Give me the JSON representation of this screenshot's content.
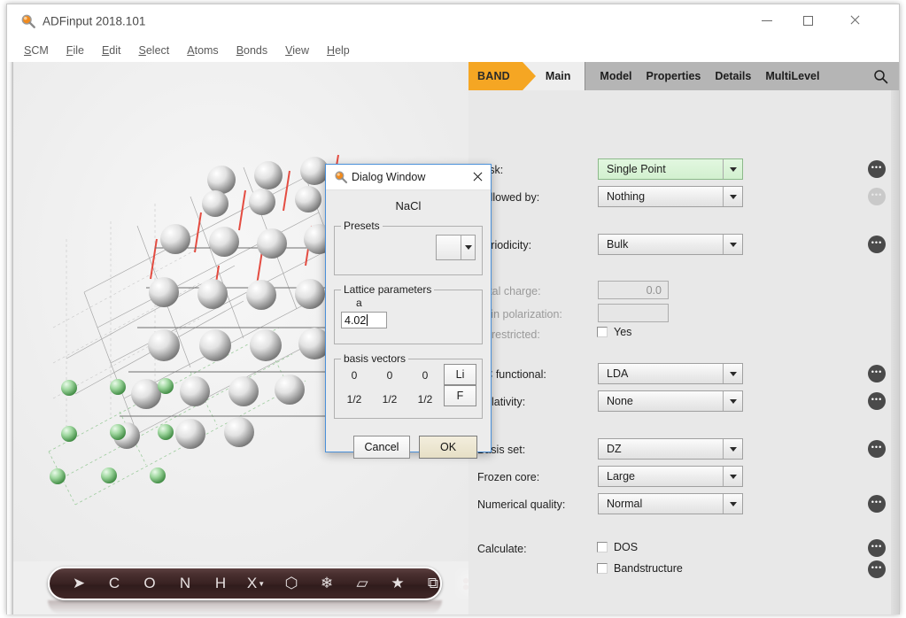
{
  "window": {
    "title": "ADFinput 2018.101",
    "icon": "magnifier-icon",
    "minimize_label": "Minimize",
    "maximize_label": "Maximize",
    "close_label": "Close"
  },
  "menubar": {
    "items": [
      {
        "label": "SCM",
        "accel": "S",
        "rest": "CM"
      },
      {
        "label": "File",
        "accel": "F",
        "rest": "ile"
      },
      {
        "label": "Edit",
        "accel": "E",
        "rest": "dit"
      },
      {
        "label": "Select",
        "accel": "S",
        "rest": "elect"
      },
      {
        "label": "Atoms",
        "accel": "A",
        "rest": "toms"
      },
      {
        "label": "Bonds",
        "accel": "B",
        "rest": "onds"
      },
      {
        "label": "View",
        "accel": "V",
        "rest": "iew"
      },
      {
        "label": "Help",
        "accel": "H",
        "rest": "elp"
      }
    ]
  },
  "toolbar": {
    "buttons": [
      {
        "name": "select-arrow-tool",
        "label": "➤"
      },
      {
        "name": "carbon-tool",
        "label": "C"
      },
      {
        "name": "oxygen-tool",
        "label": "O"
      },
      {
        "name": "nitrogen-tool",
        "label": "N"
      },
      {
        "name": "hydrogen-tool",
        "label": "H"
      },
      {
        "name": "element-x-tool",
        "label": "X"
      },
      {
        "name": "ring-tool",
        "label": "⬡"
      },
      {
        "name": "snowflake-tool",
        "label": "❄"
      },
      {
        "name": "plane-tool",
        "label": "▱"
      },
      {
        "name": "star-tool",
        "label": "★"
      },
      {
        "name": "box-tool",
        "label": "⧉"
      },
      {
        "name": "dots-tool",
        "label": "⁙",
        "selected": true
      }
    ]
  },
  "panel": {
    "product_tag": "BAND",
    "tabs": [
      {
        "label": "Main",
        "active": true
      },
      {
        "label": "Model",
        "active": false
      },
      {
        "label": "Properties",
        "active": false
      },
      {
        "label": "Details",
        "active": false
      },
      {
        "label": "MultiLevel",
        "active": false
      }
    ],
    "search_icon": "search-icon",
    "fields": [
      {
        "label": "Task:",
        "value": "Single Point",
        "type": "combo",
        "highlight": "#d6f2d2",
        "dots": "active"
      },
      {
        "label": "Followed by:",
        "value": "Nothing",
        "type": "combo",
        "dots": "disabled"
      },
      {
        "label": "Periodicity:",
        "value": "Bulk",
        "type": "combo",
        "dots": "active"
      },
      {
        "label": "Total charge:",
        "value": "0.0",
        "type": "text",
        "disabled": true
      },
      {
        "label": "Spin polarization:",
        "value": "",
        "type": "text",
        "disabled": true
      },
      {
        "label": "Unrestricted:",
        "value": "Yes",
        "type": "checkbox",
        "checked": false
      },
      {
        "label": "XC functional:",
        "value": "LDA",
        "type": "combo",
        "dots": "active"
      },
      {
        "label": "Relativity:",
        "value": "None",
        "type": "combo",
        "dots": "active"
      },
      {
        "label": "Basis set:",
        "value": "DZ",
        "type": "combo",
        "dots": "active"
      },
      {
        "label": "Frozen core:",
        "value": "Large",
        "type": "combo"
      },
      {
        "label": "Numerical quality:",
        "value": "Normal",
        "type": "combo",
        "dots": "active"
      },
      {
        "label": "Calculate:",
        "value": "DOS",
        "type": "checkbox",
        "checked": false,
        "dots": "active"
      },
      {
        "label": "",
        "value": "Bandstructure",
        "type": "checkbox",
        "checked": false,
        "dots": "active"
      }
    ],
    "dots_label": "•••"
  },
  "dialog": {
    "title": "Dialog Window",
    "icon": "magnifier-icon",
    "close_label": "Close",
    "formula": "NaCl",
    "presets": {
      "legend": "Presets",
      "value": ""
    },
    "lattice": {
      "legend": "Lattice parameters",
      "a_label": "a",
      "a_value": "4.02"
    },
    "basis": {
      "legend": "basis vectors",
      "rows": [
        {
          "x": "0",
          "y": "0",
          "z": "0",
          "element": "Li"
        },
        {
          "x": "1/2",
          "y": "1/2",
          "z": "1/2",
          "element": "F"
        }
      ]
    },
    "buttons": {
      "cancel": "Cancel",
      "ok": "OK"
    }
  },
  "colors": {
    "accent_orange": "#f5a623",
    "tab_gray": "#b5b5b5",
    "panel_bg": "#e8e8e8",
    "highlight_green": "#d6f2d2",
    "dialog_border": "#4a90d9",
    "toolbar_dark": "#3a2323",
    "atom_metal": "#d8d8d8",
    "atom_halogen": "#7ec07e"
  }
}
